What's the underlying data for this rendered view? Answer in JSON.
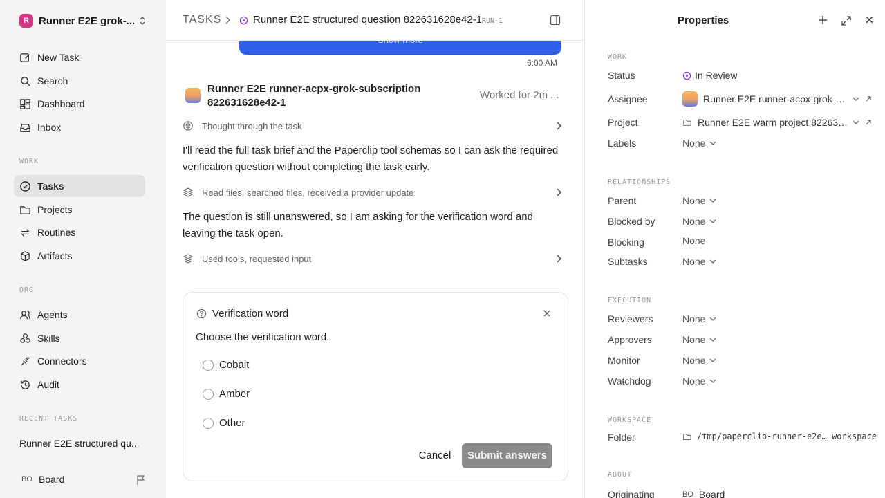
{
  "workspace": {
    "logo_letter": "R",
    "name": "Runner E2E grok-..."
  },
  "sidebar": {
    "top_items": [
      {
        "label": "New Task",
        "icon": "edit-icon"
      },
      {
        "label": "Search",
        "icon": "search-icon"
      },
      {
        "label": "Dashboard",
        "icon": "dashboard-icon"
      },
      {
        "label": "Inbox",
        "icon": "inbox-icon"
      }
    ],
    "work_label": "WORK",
    "work_items": [
      {
        "label": "Tasks",
        "icon": "check-circle-icon",
        "active": true
      },
      {
        "label": "Projects",
        "icon": "folder-icon"
      },
      {
        "label": "Routines",
        "icon": "repeat-icon"
      },
      {
        "label": "Artifacts",
        "icon": "box-icon"
      }
    ],
    "org_label": "ORG",
    "org_items": [
      {
        "label": "Agents",
        "icon": "users-icon"
      },
      {
        "label": "Skills",
        "icon": "skills-icon"
      },
      {
        "label": "Connectors",
        "icon": "plug-icon"
      },
      {
        "label": "Audit",
        "icon": "history-icon"
      }
    ],
    "recent_label": "RECENT TASKS",
    "recent_item": "Runner E2E structured qu...",
    "board": {
      "badge": "BO",
      "label": "Board"
    }
  },
  "header": {
    "crumb": "TASKS",
    "title": "Runner E2E structured question 822631628e42-1",
    "run_tag": "RUN-1"
  },
  "thread": {
    "show_more": "Show more",
    "message_time": "6:00 AM",
    "agent_name": "Runner E2E runner-acpx-grok-subscription 822631628e42-1",
    "worked_for": "Worked for 2m ...",
    "step1": "Thought through the task",
    "para1": "I'll read the full task brief and the Paperclip tool schemas so I can ask the required verification question without completing the task early.",
    "step2": "Read files, searched files, received a provider update",
    "para2": "The question is still unanswered, so I am asking for the verification word and leaving the task open.",
    "step3": "Used tools, requested input"
  },
  "question": {
    "title": "Verification word",
    "prompt": "Choose the verification word.",
    "options": [
      "Cobalt",
      "Amber",
      "Other"
    ],
    "cancel": "Cancel",
    "submit": "Submit answers"
  },
  "properties": {
    "title": "Properties",
    "work_label": "WORK",
    "status_key": "Status",
    "status_val": "In Review",
    "assignee_key": "Assignee",
    "assignee_val": "Runner E2E runner-acpx-grok-sub...",
    "project_key": "Project",
    "project_val": "Runner E2E warm project 82263162...",
    "labels_key": "Labels",
    "labels_val": "None",
    "rel_label": "RELATIONSHIPS",
    "parent_key": "Parent",
    "parent_val": "None",
    "blockedby_key": "Blocked by",
    "blockedby_val": "None",
    "blocking_key": "Blocking",
    "blocking_val": "None",
    "subtasks_key": "Subtasks",
    "subtasks_val": "None",
    "exec_label": "EXECUTION",
    "reviewers_key": "Reviewers",
    "reviewers_val": "None",
    "approvers_key": "Approvers",
    "approvers_val": "None",
    "monitor_key": "Monitor",
    "monitor_val": "None",
    "watchdog_key": "Watchdog",
    "watchdog_val": "None",
    "wsp_label": "WORKSPACE",
    "folder_key": "Folder",
    "folder_val": "/tmp/paperclip-runner-e2e… workspace",
    "about_label": "ABOUT",
    "originating_key": "Originating",
    "originating_badge": "BO",
    "originating_val": "Board"
  },
  "colors": {
    "accent": "#2f5fe8",
    "status_review": "#8b3fd9",
    "brand": "#d63384"
  }
}
